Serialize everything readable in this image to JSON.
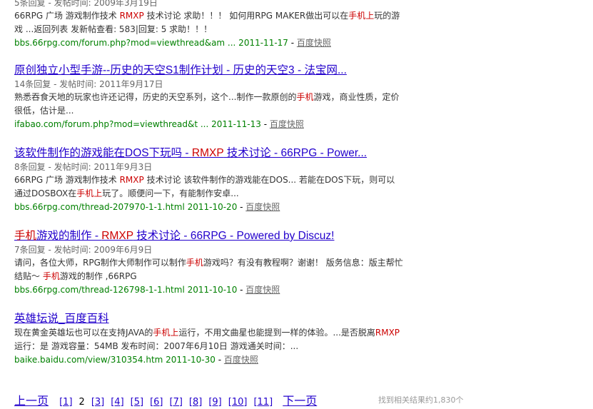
{
  "results": [
    {
      "meta": "5条回复 - 发帖时间: 2009年3月19日",
      "snippet": [
        {
          "t": "66RPG 广场  游戏制作技术  "
        },
        {
          "t": "RMXP",
          "hl": true
        },
        {
          "t": " 技术讨论  求助！！！ 如何用RPG MAKER做出可以在"
        },
        {
          "t": "手机上",
          "hl": true
        },
        {
          "t": "玩的游戏  ...返回列表  发新帖查看: 583|回复: 5 求助！！！"
        }
      ],
      "url": "bbs.66rpg.com/forum.php?mod=viewthread&am ... 2011-11-17",
      "snapshot": "百度快照"
    },
    {
      "title": "原创独立小型手游--历史的天空S1制作计划  - 历史的天空3 - 法宝网...",
      "meta": "14条回复 - 发帖时间: 2011年9月17日",
      "snippet": [
        {
          "t": "熟悉吞食天地的玩家也许还记得，历史的天空系列，这个...制作一款原创的"
        },
        {
          "t": "手机",
          "hl": true
        },
        {
          "t": "游戏，商业性质，定价很低，估计是..."
        }
      ],
      "url": "ifabao.com/forum.php?mod=viewthread&t ... 2011-11-13",
      "snapshot": "百度快照"
    },
    {
      "title_parts": [
        {
          "t": "该软件制作的游戏能在DOS下玩吗  - "
        },
        {
          "t": "RMXP",
          "hl": true
        },
        {
          "t": " 技术讨论  - 66RPG - Power..."
        }
      ],
      "meta": "8条回复 - 发帖时间: 2011年9月3日",
      "snippet": [
        {
          "t": "66RPG 广场  游戏制作技术  "
        },
        {
          "t": "RMXP",
          "hl": true
        },
        {
          "t": " 技术讨论  该软件制作的游戏能在DOS... 若能在DOS下玩，则可以通过DOSBOX在"
        },
        {
          "t": "手机上",
          "hl": true
        },
        {
          "t": "玩了。顺便问一下，有能制作安卓..."
        }
      ],
      "url": "bbs.66rpg.com/thread-207970-1-1.html 2011-10-20",
      "snapshot": "百度快照"
    },
    {
      "title_parts": [
        {
          "t": "手机",
          "hl": true
        },
        {
          "t": "游戏的制作  - "
        },
        {
          "t": "RMXP",
          "hl": true
        },
        {
          "t": " 技术讨论  - 66RPG - Powered by Discuz!"
        }
      ],
      "meta": "7条回复 - 发帖时间: 2009年6月9日",
      "snippet": [
        {
          "t": "请问，各位大师，RPG制作大师制作可以制作"
        },
        {
          "t": "手机",
          "hl": true
        },
        {
          "t": "游戏吗？有没有教程啊？谢谢！   版务信息：版主帮忙结贴～ "
        },
        {
          "t": "手机",
          "hl": true
        },
        {
          "t": "游戏的制作  ,66RPG"
        }
      ],
      "url": "bbs.66rpg.com/thread-126798-1-1.html 2011-10-10",
      "snapshot": "百度快照"
    },
    {
      "title": "英雄坛说_百度百科",
      "meta": "",
      "snippet": [
        {
          "t": "现在黄金英雄坛也可以在支持JAVA的"
        },
        {
          "t": "手机上",
          "hl": true
        },
        {
          "t": "运行，不用文曲星也能提到一样的体验。...是否脱离"
        },
        {
          "t": "RMXP",
          "hl": true
        },
        {
          "t": "运行：是  游戏容量：54MB 发布时间：2007年6月10日  游戏通关时间：..."
        }
      ],
      "url": "baike.baidu.com/view/310354.htm 2011-10-30",
      "snapshot": "百度快照"
    }
  ],
  "pager": {
    "prev": "上一页",
    "pages": [
      "[1]",
      "2",
      "[3]",
      "[4]",
      "[5]",
      "[6]",
      "[7]",
      "[8]",
      "[9]",
      "[10]",
      "[11]"
    ],
    "current": "2",
    "next": "下一页"
  },
  "result_count": "找到相关结果约1,830个",
  "colors": {
    "title_link": "#2200cc",
    "highlight": "#cc0000",
    "url": "#008000",
    "meta": "#666666"
  }
}
